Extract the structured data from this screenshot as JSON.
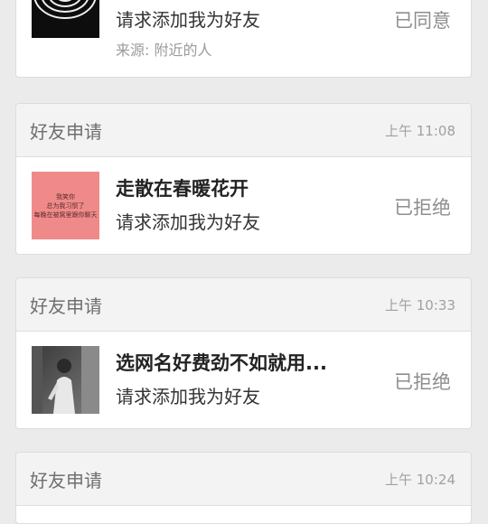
{
  "requests": [
    {
      "message": "请求添加我为好友",
      "source": "来源: 附近的人",
      "status": "已同意",
      "avatar_icon": "spiral-avatar"
    },
    {
      "header": "好友申请",
      "time": "上午 11:08",
      "name": "走散在春暖花开",
      "message": "请求添加我为好友",
      "status": "已拒绝",
      "avatar_icon": "pink-text-avatar",
      "avatar_text": [
        "我笑你",
        "总为我习惯了",
        "每晚在被窝里跟你聊天"
      ]
    },
    {
      "header": "好友申请",
      "time": "上午 10:33",
      "name": "选网名好费劲不如就用...",
      "message": "请求添加我为好友",
      "status": "已拒绝",
      "avatar_icon": "photo-avatar"
    },
    {
      "header": "好友申请",
      "time": "上午 10:24"
    }
  ],
  "colors": {
    "background": "#ebebeb",
    "card": "#ffffff",
    "header_bg": "#f3f3f3",
    "avatar_pink": "#f08a8a"
  }
}
